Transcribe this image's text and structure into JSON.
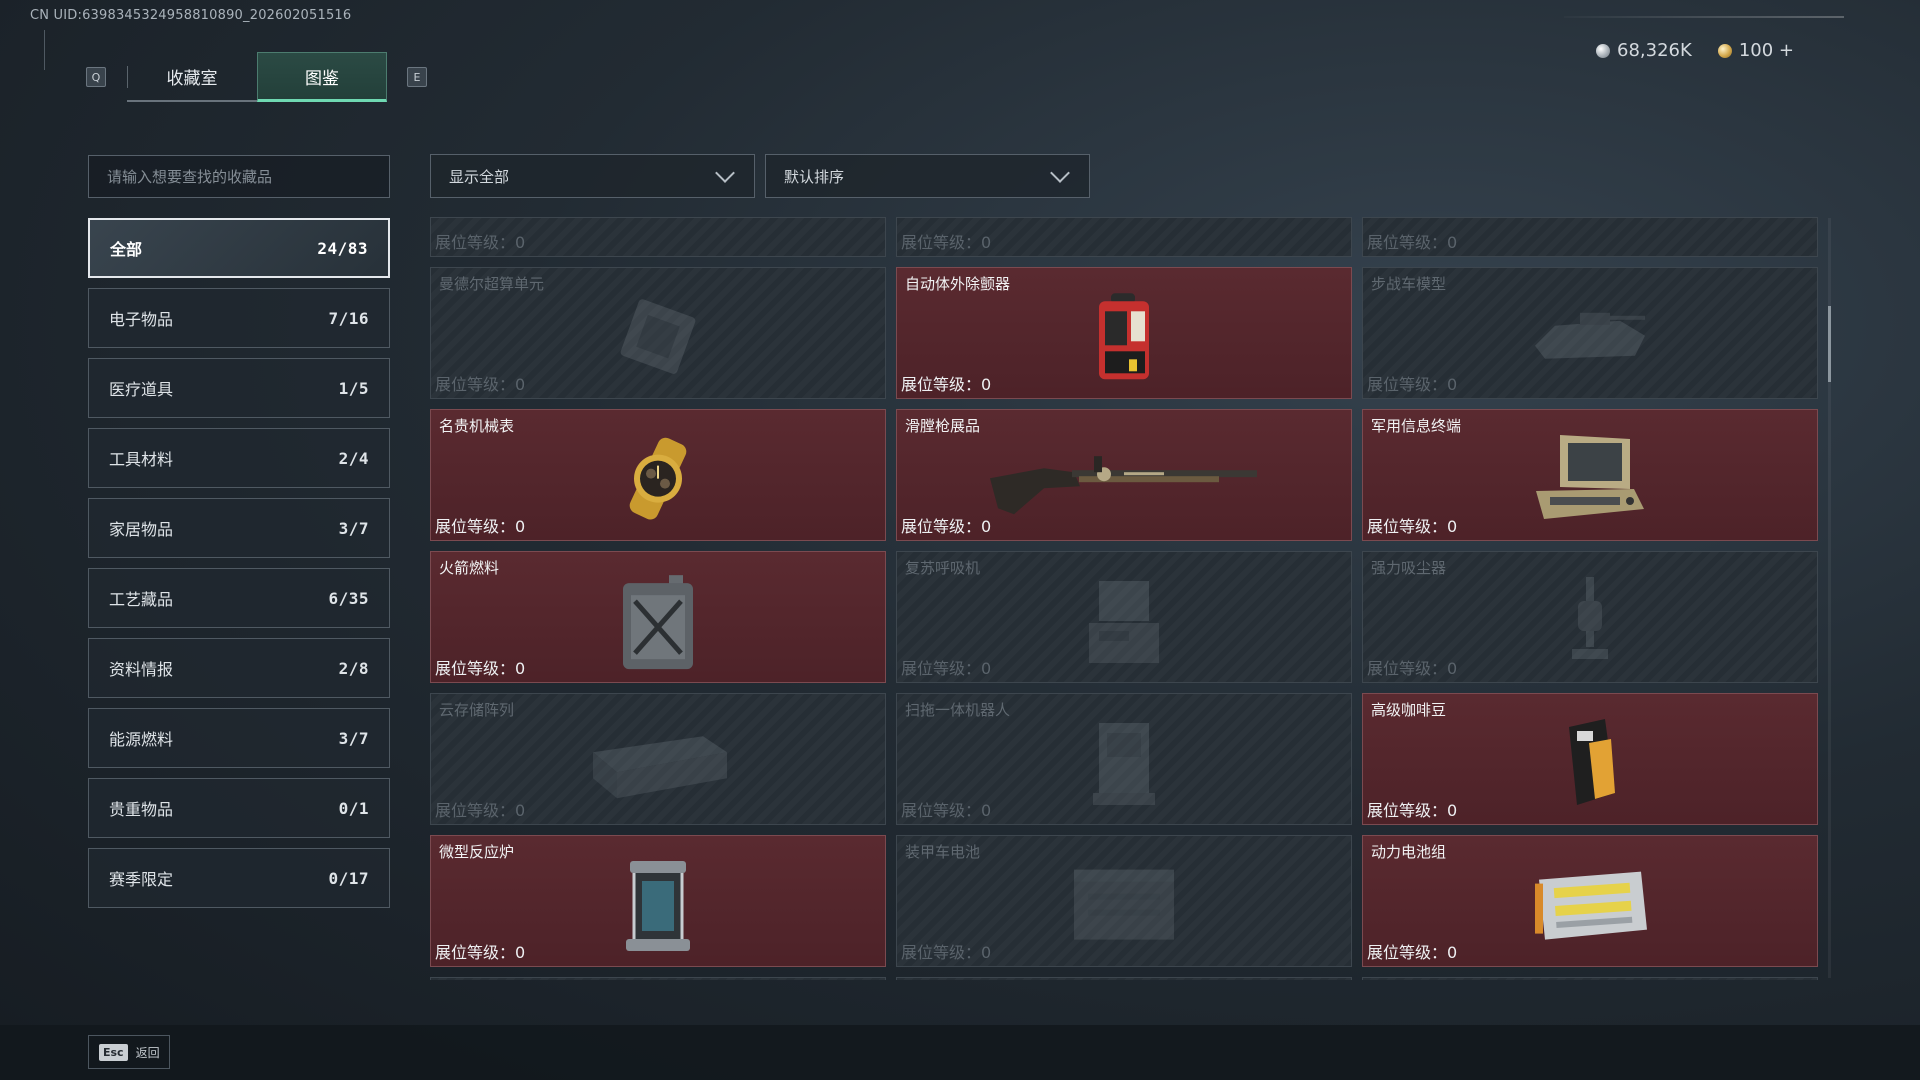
{
  "header": {
    "uid": "CN UID:6398345324958810890_202602051516",
    "key_left": "Q",
    "key_right": "E",
    "tabs": [
      {
        "label": "收藏室",
        "active": false
      },
      {
        "label": "图鉴",
        "active": true
      }
    ],
    "currency": [
      {
        "icon": "silver-coin-icon",
        "value": "68,326K"
      },
      {
        "icon": "gold-coin-icon",
        "value": "100 +"
      }
    ]
  },
  "search": {
    "placeholder": "请输入想要查找的收藏品",
    "value": ""
  },
  "filters": {
    "display": {
      "value": "显示全部"
    },
    "sort": {
      "value": "默认排序"
    }
  },
  "categories": [
    {
      "label": "全部",
      "count": "24/83",
      "active": true
    },
    {
      "label": "电子物品",
      "count": "7/16"
    },
    {
      "label": "医疗道具",
      "count": "1/5"
    },
    {
      "label": "工具材料",
      "count": "2/4"
    },
    {
      "label": "家居物品",
      "count": "3/7"
    },
    {
      "label": "工艺藏品",
      "count": "6/35"
    },
    {
      "label": "资料情报",
      "count": "2/8"
    },
    {
      "label": "能源燃料",
      "count": "3/7"
    },
    {
      "label": "贵重物品",
      "count": "0/1"
    },
    {
      "label": "赛季限定",
      "count": "0/17"
    }
  ],
  "level_label": "展位等级：",
  "top_partial_levels": [
    "0",
    "0",
    "0"
  ],
  "items": [
    {
      "name": "曼德尔超算单元",
      "level": "0",
      "owned": false,
      "icon": "computer-unit-icon"
    },
    {
      "name": "自动体外除颤器",
      "level": "0",
      "owned": true,
      "icon": "defibrillator-icon"
    },
    {
      "name": "步战车模型",
      "level": "0",
      "owned": false,
      "icon": "ifv-model-icon"
    },
    {
      "name": "名贵机械表",
      "level": "0",
      "owned": true,
      "icon": "watch-icon"
    },
    {
      "name": "滑膛枪展品",
      "level": "0",
      "owned": true,
      "icon": "musket-icon"
    },
    {
      "name": "军用信息终端",
      "level": "0",
      "owned": true,
      "icon": "military-terminal-icon"
    },
    {
      "name": "火箭燃料",
      "level": "0",
      "owned": true,
      "icon": "fuel-can-icon"
    },
    {
      "name": "复苏呼吸机",
      "level": "0",
      "owned": false,
      "icon": "ventilator-icon"
    },
    {
      "name": "强力吸尘器",
      "level": "0",
      "owned": false,
      "icon": "vacuum-icon"
    },
    {
      "name": "云存储阵列",
      "level": "0",
      "owned": false,
      "icon": "storage-array-icon"
    },
    {
      "name": "扫拖一体机器人",
      "level": "0",
      "owned": false,
      "icon": "robot-vacuum-icon"
    },
    {
      "name": "高级咖啡豆",
      "level": "0",
      "owned": true,
      "icon": "coffee-bag-icon"
    },
    {
      "name": "微型反应炉",
      "level": "0",
      "owned": true,
      "icon": "reactor-icon"
    },
    {
      "name": "装甲车电池",
      "level": "0",
      "owned": false,
      "icon": "armored-battery-icon"
    },
    {
      "name": "动力电池组",
      "level": "0",
      "owned": true,
      "icon": "battery-pack-icon"
    }
  ],
  "footer": {
    "esc_key": "Esc",
    "back_label": "返回"
  },
  "colors": {
    "accent": "#6fd9b2",
    "owned_card": "#5a2a30",
    "locked_card": "#262e35"
  }
}
